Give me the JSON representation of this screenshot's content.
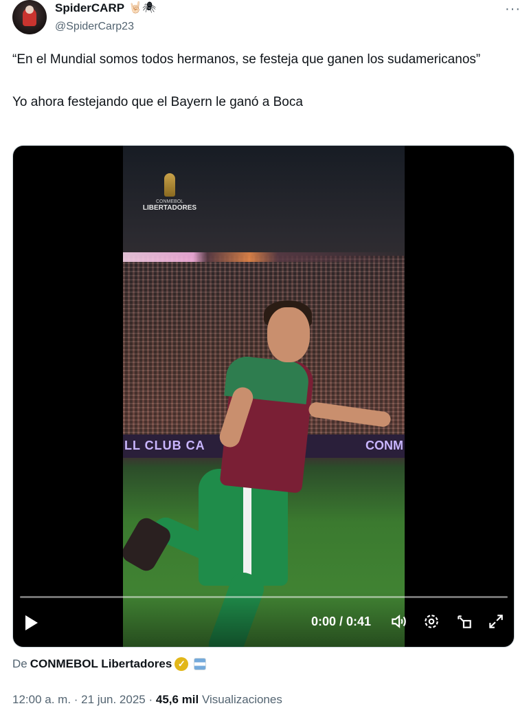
{
  "tweet": {
    "display_name": "SpiderCARP",
    "name_emojis": "🤘🏻🕷",
    "handle": "@SpiderCarp23",
    "more_label": "···",
    "paragraph_1": "“En el Mundial somos todos hermanos, se festeja que ganen los sudamericanos”",
    "paragraph_2": "Yo ahora festejando que el Bayern le ganó a Boca"
  },
  "video": {
    "watermark_small": "CONMEBOL",
    "watermark_big": "LIBERTADORES",
    "board_left": "LL CLUB CA",
    "board_right": "CONM",
    "time": "0:00 / 0:41",
    "progress": 0.0
  },
  "source": {
    "prefix": "De",
    "name": "CONMEBOL Libertadores"
  },
  "meta": {
    "timestamp": "12:00 a. m. · 21 jun. 2025 ·",
    "views_count": "45,6 mil",
    "views_label": "Visualizaciones"
  }
}
